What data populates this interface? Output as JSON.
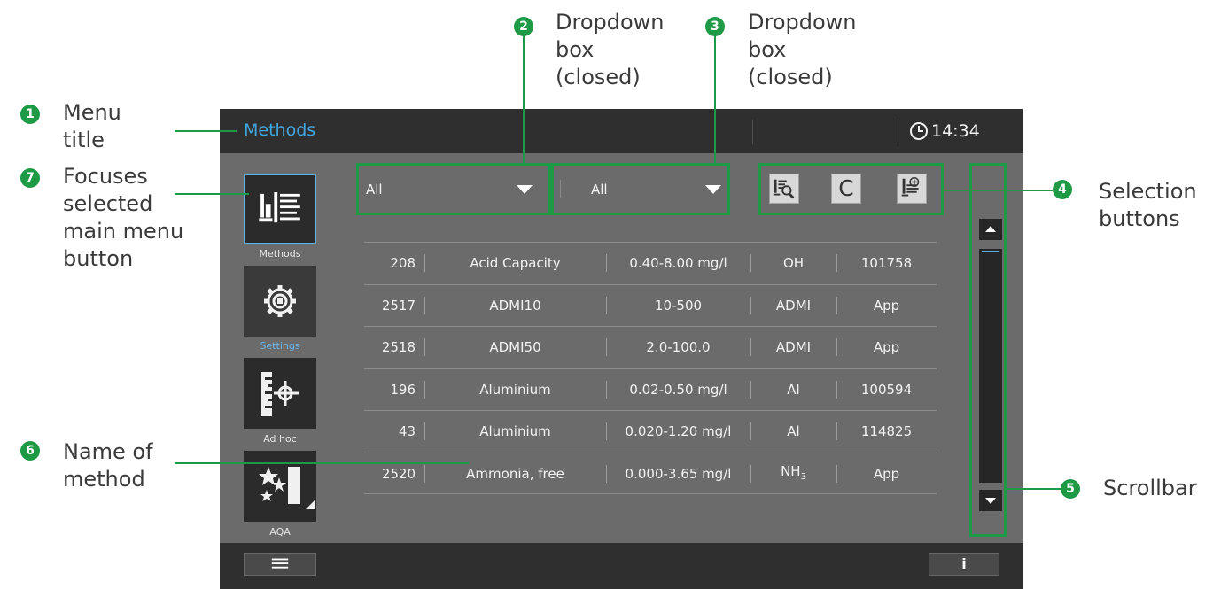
{
  "screen": {
    "title": "Methods",
    "clock": "14:34",
    "nav": [
      {
        "label": "Methods",
        "icon": "methods-list-icon",
        "selected": true
      },
      {
        "label": "Settings",
        "icon": "gear-icon",
        "selected": false
      },
      {
        "label": "Ad hoc",
        "icon": "ruler-target-icon",
        "selected": false
      },
      {
        "label": "AQA",
        "icon": "stars-icon",
        "selected": false
      }
    ],
    "dropdown1": {
      "value": "All"
    },
    "dropdown2": {
      "value": "All"
    },
    "selection_buttons": [
      {
        "icon": "search-list-icon"
      },
      {
        "icon": "C"
      },
      {
        "icon": "add-list-icon"
      }
    ],
    "table": {
      "rows": [
        {
          "id": "208",
          "name": "Acid Capacity",
          "range": "0.40-8.00 mg/l",
          "unit": "OH",
          "ref": "101758"
        },
        {
          "id": "2517",
          "name": "ADMI10",
          "range": "10-500",
          "unit": "ADMI",
          "ref": "App"
        },
        {
          "id": "2518",
          "name": "ADMI50",
          "range": "2.0-100.0",
          "unit": "ADMI",
          "ref": "App"
        },
        {
          "id": "196",
          "name": "Aluminium",
          "range": "0.02-0.50 mg/l",
          "unit": "Al",
          "ref": "100594"
        },
        {
          "id": "43",
          "name": "Aluminium",
          "range": "0.020-1.20 mg/l",
          "unit": "Al",
          "ref": "114825"
        },
        {
          "id": "2520",
          "name": "Ammonia, free",
          "range": "0.000-3.65 mg/l",
          "unit": "NH",
          "unit_sub": "3",
          "ref": "App"
        }
      ]
    },
    "info_label": "i"
  },
  "annotations": [
    {
      "num": "1",
      "text": "Menu\ntitle"
    },
    {
      "num": "2",
      "text": "Dropdown\nbox\n(closed)"
    },
    {
      "num": "3",
      "text": "Dropdown\nbox\n(closed)"
    },
    {
      "num": "4",
      "text": "Selection\nbuttons"
    },
    {
      "num": "5",
      "text": "Scrollbar"
    },
    {
      "num": "6",
      "text": "Name of\nmethod"
    },
    {
      "num": "7",
      "text": "Focuses\nselected\nmain menu\nbutton"
    }
  ],
  "colors": {
    "accent": "#1e9a46",
    "title_blue": "#41a6e0",
    "screen_bg": "#6b6b6b",
    "bar_bg": "#2f2f2f"
  }
}
